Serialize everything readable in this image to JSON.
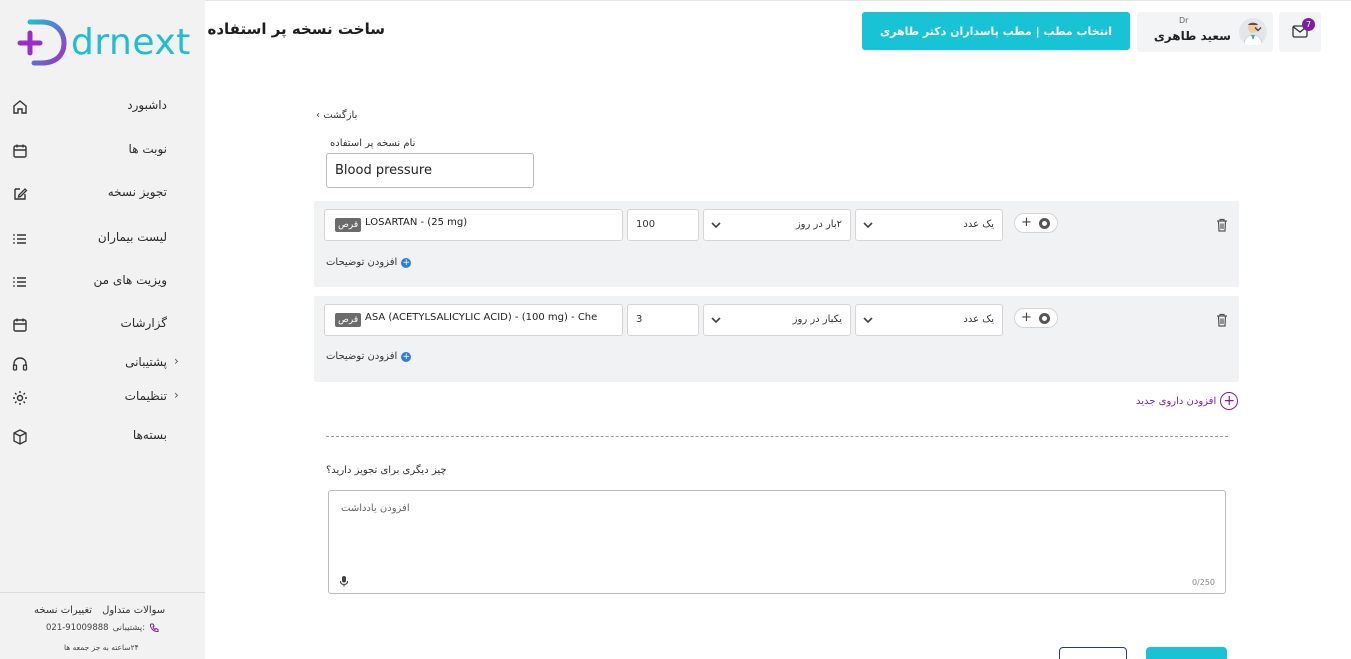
{
  "app": {
    "logo_text": "drnext"
  },
  "header": {
    "title": "ساخت نسخه پر استفاده",
    "clinic_button": "انتخاب مطب | مطب پاسداران دکتر طاهری",
    "user": {
      "prefix": "Dr",
      "name": "سعید طاهری"
    },
    "messages_badge": "7"
  },
  "sidebar": {
    "items": [
      {
        "label": "داشبورد",
        "icon": "home-icon"
      },
      {
        "label": "نوبت ها",
        "icon": "calendar-icon"
      },
      {
        "label": "تجویز نسخه",
        "icon": "edit-icon"
      },
      {
        "label": "لیست بیماران",
        "icon": "list-icon"
      },
      {
        "label": "ویزیت های من",
        "icon": "list-icon"
      },
      {
        "label": "گزارشات",
        "icon": "calendar-icon"
      },
      {
        "label": "پشتیبانی",
        "icon": "headset-icon"
      },
      {
        "label": "تنظیمات",
        "icon": "gear-icon"
      },
      {
        "label": "بسته‌ها",
        "icon": "package-icon"
      }
    ],
    "footer": {
      "faq": "سوالات متداول",
      "changes": "تغییرات نسخه",
      "support_label": "پشتیبانی:",
      "phone": "021-91009888",
      "hours": "۲۴ساعته به جز جمعه ها"
    }
  },
  "form": {
    "back_label": "بازگشت",
    "name_label": "نام نسخه پر استفاده",
    "name_value": "Blood pressure",
    "drugs": [
      {
        "tag": "قرص",
        "name": "LOSARTAN - (25 mg)",
        "qty": "100",
        "frequency": "۲بار در روز",
        "dose": "یک عدد",
        "add_description": "افزودن توضیحات"
      },
      {
        "tag": "قرص",
        "name": "ASA (ACETYLSALICYLIC ACID) - (100 mg) - Che",
        "qty": "3",
        "frequency": "یکبار در روز",
        "dose": "یک عدد",
        "add_description": "افزودن توضیحات"
      }
    ],
    "add_new_drug": "افزودن داروی جدید",
    "other_question": "چیز دیگری برای تجویز دارید؟",
    "note_placeholder": "افزودن یادداشت",
    "note_counter": "0/250"
  },
  "colors": {
    "accent": "#19c3d6",
    "purple": "#7b1fa2",
    "sidebar_bg": "#f2f2f2"
  }
}
